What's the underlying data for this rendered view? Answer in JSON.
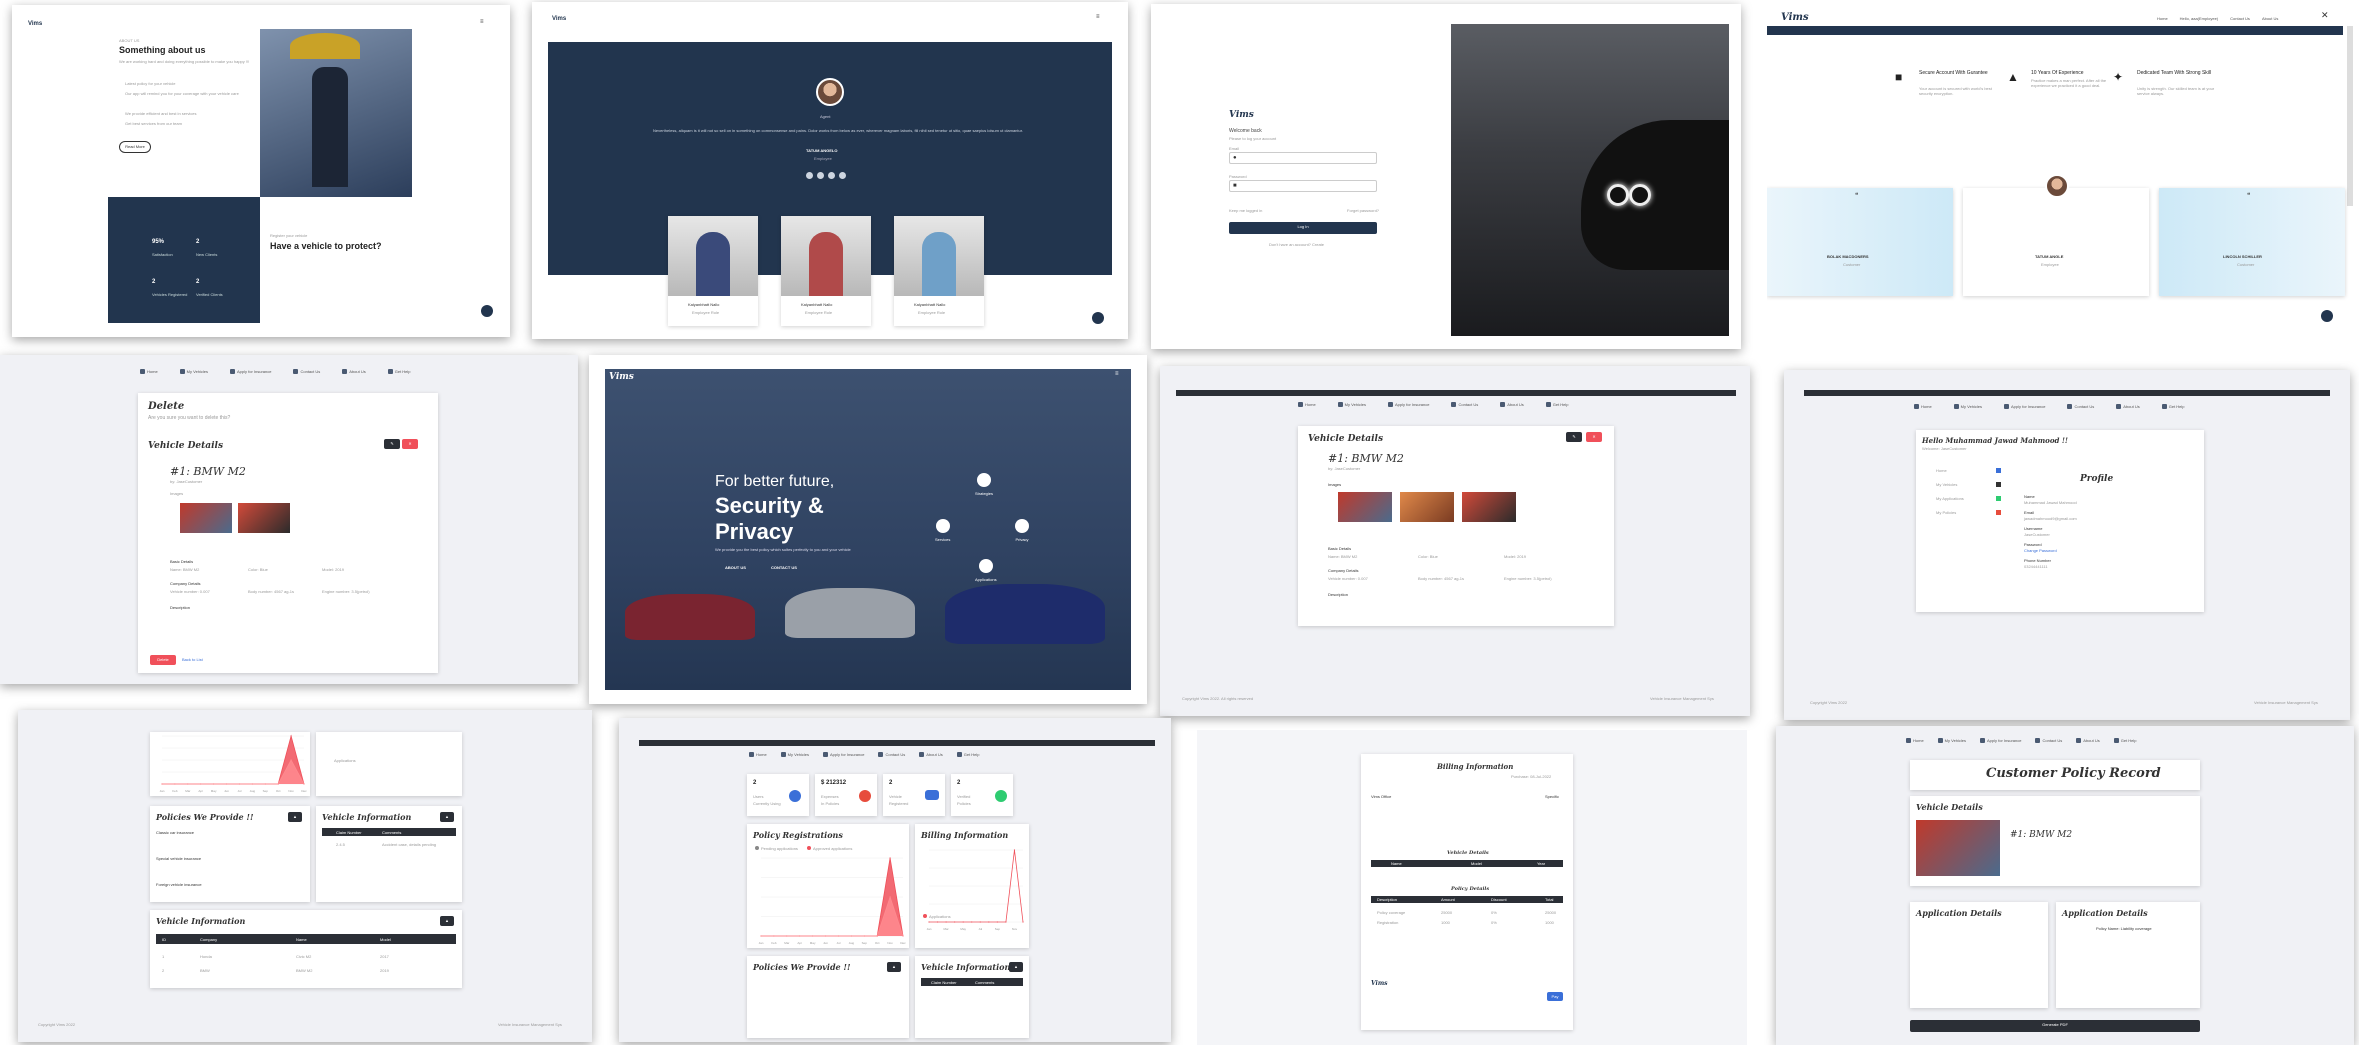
{
  "s1": {
    "brand": "Vims",
    "small": "ABOUT US",
    "title": "Something about us",
    "intro": "We are working hard and doing everything possible to make you happy !!!",
    "items": [
      "Latest policy for your vehicle",
      "Our app will remind you for your coverage with your vehicle care",
      "We provide efficient and best in services",
      "Get best services from our team"
    ],
    "button": "Read More",
    "stats": [
      {
        "n": "95%",
        "l": "Satisfaction"
      },
      {
        "n": "2",
        "l": "New Clients"
      },
      {
        "n": "2",
        "l": "Vehicles Registered"
      },
      {
        "n": "2",
        "l": "Verified Clients"
      }
    ],
    "cta_small": "Register your vehicle",
    "cta_title": "Have a vehicle to protect?"
  },
  "s2": {
    "brand": "Vims",
    "role": "Agent",
    "quote": "Nevertheless, aliquam is it will not so sell on in something on commonsense and pains. Dolor works from below as ever, wherever magnam laboris, fill nihil sed tenetur ut sitio, quae saepius lolsum ut clamantur.",
    "name": "TATUM ANGELO",
    "position": "Employee",
    "team": [
      {
        "name": "Kalyanbhatt Nallo",
        "role": "Employee Role"
      },
      {
        "name": "Kalyanbhatt Nallo",
        "role": "Employee Role"
      },
      {
        "name": "Kalyanbhatt Nallo",
        "role": "Employee Role"
      }
    ]
  },
  "s3": {
    "brand": "Vims",
    "welcome": "Welcome back",
    "sub": "Please to log your account",
    "email": "Email",
    "password": "Password",
    "remember": "Keep me logged in",
    "forgot": "Forget password?",
    "login": "Log In",
    "signup": "Don't have an account? Create"
  },
  "s4": {
    "brand": "Vims",
    "nav": [
      "Home",
      "Hello, aaa(Employee)",
      "Contact Us",
      "About Us"
    ],
    "features": [
      {
        "t": "Secure Account With Gurantee",
        "d": "Your account is secured with world's best security encryption."
      },
      {
        "t": "10 Years Of Experience",
        "d": "Practice makes a man perfect. After all the experience we practiced it a good deal."
      },
      {
        "t": "Dedicated Team With Strong Skill",
        "d": "Unity is strength. Our skilled team is at your service always."
      }
    ],
    "testimonials": [
      {
        "name": "BOLAK MACDONERS",
        "role": "Customer"
      },
      {
        "name": "TATUM ANGLE",
        "role": "Employee"
      },
      {
        "name": "LINCOLN SCHILLER",
        "role": "Customer"
      }
    ]
  },
  "nav": [
    "Home",
    "My Vehicles",
    "Apply for Insurance",
    "Contact Us",
    "About Us",
    "Get Help"
  ],
  "s5": {
    "title": "Delete",
    "sub": "Are you sure you want to delete this?",
    "card_title": "Vehicle Details",
    "vehicle": "#1: BMW M2",
    "owner": "by: JaseCustomer",
    "images": "Images",
    "model_details": "Basic Details",
    "fields": [
      "Name: BMW M2",
      "Color: Blue",
      "Model: 2019"
    ],
    "company": "Company Details",
    "cfields": [
      "Vehicle number: 0.007",
      "Body number: 4567 ag-1s",
      "Engine number: 3.5(petrol)"
    ],
    "desc": "Description",
    "delete": "Delete",
    "back": "Back to List"
  },
  "s6": {
    "brand": "Vims",
    "line1": "For better future,",
    "line2": "Security &",
    "line3": "Privacy",
    "sub": "We provide you the best policy which suites perfectly to you and your vehicle",
    "btn1": "ABOUT US",
    "btn2": "CONTACT US",
    "features": [
      "Strategies",
      "Services",
      "Privacy",
      "Applications"
    ]
  },
  "s7": {
    "card_title": "Vehicle Details",
    "vehicle": "#1: BMW M2",
    "owner": "by: JaseCustomer",
    "images": "Images",
    "basic": "Basic Details",
    "fields": [
      "Name: BMW M2",
      "Color: Blue",
      "Model: 2019"
    ],
    "company": "Company Details",
    "cfields": [
      "Vehicle number: 0.007",
      "Body number: 4567 ag-1s",
      "Engine number: 3.5(petrol)"
    ],
    "desc": "Description",
    "footer_l": "Copyright Vims 2022. All rights reserved",
    "footer_r": "Vehicle Insurance Management Sys"
  },
  "s8": {
    "hello": "Hello Muhammad Jawad Mahmood !!",
    "sub": "Welcome: JaseCustomer",
    "title": "Profile",
    "menu": [
      "Home",
      "My Vehicles",
      "My Applications",
      "My Policies"
    ],
    "fields": [
      {
        "l": "Name",
        "v": "Muhammad Jawad Mahmood"
      },
      {
        "l": "Email",
        "v": "jawadmahmood9@gmail.com"
      },
      {
        "l": "Username",
        "v": "JaseCustomer"
      },
      {
        "l": "Password",
        "v": "Change Password"
      },
      {
        "l": "Phone Number",
        "v": "03244441111"
      }
    ],
    "footer_l": "Copyright Vims 2022",
    "footer_r": "Vehicle Insurance Management Sys"
  },
  "s9": {
    "policies_title": "Policies We Provide !!",
    "vehicle_info": "Vehicle Information",
    "policy_items": [
      "Classic car insurance",
      "Special vehicle insurance",
      "Foreign vehicle insurance"
    ],
    "claim_cols": [
      "Claim Number",
      "Comments"
    ],
    "claim_rows": [
      [
        "2.4.5",
        "Accident case, details pending"
      ]
    ],
    "vt_cols": [
      "ID",
      "Company",
      "Name",
      "Model"
    ],
    "vt_rows": [
      [
        "1",
        "Honda",
        "Civic M2",
        "2017"
      ],
      [
        "2",
        "BMW",
        "BMW M2",
        "2019"
      ]
    ],
    "legend": "Applications",
    "footer_l": "Copyright Vims 2022",
    "footer_r": "Vehicle Insurance Management Sys"
  },
  "s10": {
    "stats": [
      {
        "n": "2",
        "l": "Users",
        "s": "Currently Using"
      },
      {
        "n": "$ 212312",
        "l": "Expenses",
        "s": "In Policies"
      },
      {
        "n": "2",
        "l": "Vehicle",
        "s": "Registered"
      },
      {
        "n": "2",
        "l": "Verified",
        "s": "Policies"
      }
    ],
    "chart1": "Policy Registrations",
    "chart2": "Billing Information",
    "legend1": [
      "Pending applications",
      "Approved applications"
    ],
    "legend2": "Applications",
    "policies_title": "Policies We Provide !!",
    "vehicle_info": "Vehicle Information",
    "claim_cols": [
      "Claim Number",
      "Comments"
    ]
  },
  "chart_data": [
    {
      "type": "area",
      "title": "Policy Registrations",
      "categories": [
        "Jan",
        "Feb",
        "Mar",
        "Apr",
        "May",
        "Jun",
        "Jul",
        "Aug",
        "Sep",
        "Oct",
        "Nov",
        "Dec"
      ],
      "series": [
        {
          "name": "Pending applications",
          "values": [
            0,
            0,
            0,
            0,
            0,
            0,
            0,
            0,
            0,
            0,
            2,
            0
          ]
        },
        {
          "name": "Approved applications",
          "values": [
            0,
            0,
            0,
            0,
            0,
            0,
            0,
            0,
            0,
            0,
            1,
            0
          ]
        }
      ]
    },
    {
      "type": "line",
      "title": "Billing Information",
      "categories": [
        "Jan",
        "Feb",
        "Mar",
        "Apr",
        "May",
        "Jun",
        "Jul",
        "Aug",
        "Sep",
        "Oct",
        "Nov",
        "Dec"
      ],
      "series": [
        {
          "name": "Applications",
          "values": [
            0,
            0,
            0,
            0,
            0,
            0,
            0,
            0,
            0,
            0,
            2,
            0
          ]
        }
      ]
    }
  ],
  "s11": {
    "title": "Billing Information",
    "date": "Purchase: 08-Jul-2022",
    "from": "Vims Office",
    "to": "Specific",
    "vtitle": "Vehicle Details",
    "ptitle": "Policy Details",
    "vcols": [
      "Name",
      "Model",
      "Year"
    ],
    "pcols": [
      "Description",
      "Amount",
      "Discount",
      "Total"
    ],
    "prows": [
      [
        "Policy coverage",
        "25000",
        "0%",
        "25000"
      ],
      [
        "Registration",
        "1000",
        "0%",
        "1000"
      ]
    ],
    "brand": "Vims",
    "pay": "Pay"
  },
  "s12": {
    "title": "Customer Policy Record",
    "vtitle": "Vehicle Details",
    "vehicle": "#1: BMW M2",
    "app_title": "Application Details",
    "app2_title": "Application Details",
    "policy": "Policy Name: Liability coverage",
    "button": "Generate PDF"
  }
}
